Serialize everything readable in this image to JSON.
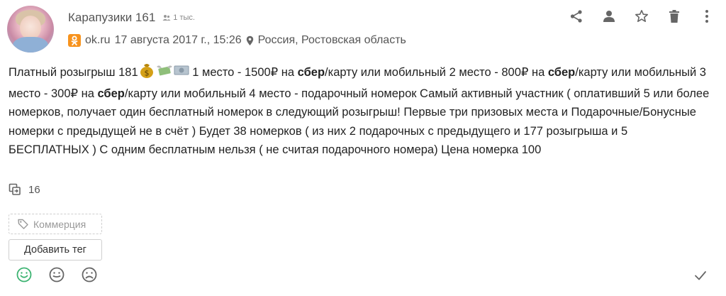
{
  "author": {
    "name": "Карапузики 161",
    "members": "1 тыс."
  },
  "meta": {
    "source": "ok.ru",
    "date": "17 августа 2017 г., 15:26",
    "location": "Россия, Ростовская область"
  },
  "actions": {
    "icons": [
      "share-icon",
      "user-icon",
      "star-icon",
      "trash-icon",
      "more-vertical-icon"
    ]
  },
  "post": {
    "p1": "Платный розыгрыш 181",
    "p2": " 1 место - 1500₽ на ",
    "b1": "сбер",
    "p3": "/карту или мобильный 2 место - 800₽ на ",
    "b2": "сбер",
    "p4": "/карту или мобильный 3 место - 300₽ на ",
    "b3": "сбер",
    "p5": "/карту или мобильный 4 место - подарочный номерок Самый активный участник ( оплативший 5 или более номерков, получает один бесплатный номерок в следующий розыгрыш! Первые три призовых места и Подарочные/Бонусные номерки с предыдущей не в счёт ) Будет 38 номерков ( из них 2 подарочных с предыдущего и 177 розыгрыша и 5 БЕСПЛАТНЫХ ) С одним бесплатным нельзя ( не считая подарочного номера) Цена номерка 100"
  },
  "reposts": {
    "count": "16"
  },
  "tags": {
    "commerce": "Коммерция",
    "add_tag": "Добавить тег"
  },
  "colors": {
    "ok_orange": "#f7931e",
    "positive_green": "#3cb371",
    "icon_gray": "#666666"
  }
}
